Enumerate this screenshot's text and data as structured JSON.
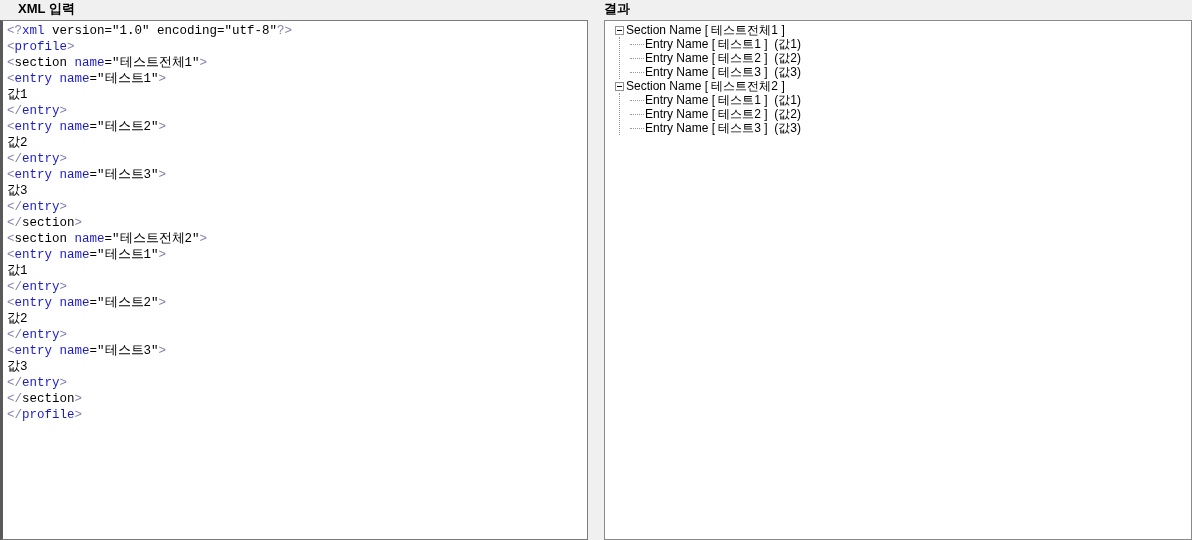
{
  "editor": {
    "title": "XML 입력",
    "lines": [
      [
        {
          "kind": "p",
          "text": "<?"
        },
        {
          "kind": "t",
          "text": "xml"
        },
        {
          "kind": "x",
          "text": " version=\"1.0\" encoding=\"utf-8\""
        },
        {
          "kind": "p",
          "text": "?>"
        }
      ],
      [
        {
          "kind": "p",
          "text": "<"
        },
        {
          "kind": "t",
          "text": "profile"
        },
        {
          "kind": "p",
          "text": ">"
        }
      ],
      [
        {
          "kind": "p",
          "text": "<"
        },
        {
          "kind": "x",
          "text": "section "
        },
        {
          "kind": "t",
          "text": "name"
        },
        {
          "kind": "x",
          "text": "=\"테스트전체1\""
        },
        {
          "kind": "p",
          "text": ">"
        }
      ],
      [
        {
          "kind": "p",
          "text": "<"
        },
        {
          "kind": "t",
          "text": "entry name"
        },
        {
          "kind": "x",
          "text": "=\"테스트1\""
        },
        {
          "kind": "p",
          "text": ">"
        }
      ],
      [
        {
          "kind": "x",
          "text": "값1"
        }
      ],
      [
        {
          "kind": "p",
          "text": "</"
        },
        {
          "kind": "t",
          "text": "entry"
        },
        {
          "kind": "p",
          "text": ">"
        }
      ],
      [
        {
          "kind": "p",
          "text": "<"
        },
        {
          "kind": "t",
          "text": "entry name"
        },
        {
          "kind": "x",
          "text": "=\"테스트2\""
        },
        {
          "kind": "p",
          "text": ">"
        }
      ],
      [
        {
          "kind": "x",
          "text": "값2"
        }
      ],
      [
        {
          "kind": "p",
          "text": "</"
        },
        {
          "kind": "t",
          "text": "entry"
        },
        {
          "kind": "p",
          "text": ">"
        }
      ],
      [
        {
          "kind": "p",
          "text": "<"
        },
        {
          "kind": "t",
          "text": "entry name"
        },
        {
          "kind": "x",
          "text": "=\"테스트3\""
        },
        {
          "kind": "p",
          "text": ">"
        }
      ],
      [
        {
          "kind": "x",
          "text": "값3"
        }
      ],
      [
        {
          "kind": "p",
          "text": "</"
        },
        {
          "kind": "t",
          "text": "entry"
        },
        {
          "kind": "p",
          "text": ">"
        }
      ],
      [
        {
          "kind": "p",
          "text": "</"
        },
        {
          "kind": "x",
          "text": "section"
        },
        {
          "kind": "p",
          "text": ">"
        }
      ],
      [
        {
          "kind": "p",
          "text": "<"
        },
        {
          "kind": "x",
          "text": "section "
        },
        {
          "kind": "t",
          "text": "name"
        },
        {
          "kind": "x",
          "text": "=\"테스트전체2\""
        },
        {
          "kind": "p",
          "text": ">"
        }
      ],
      [
        {
          "kind": "p",
          "text": "<"
        },
        {
          "kind": "t",
          "text": "entry name"
        },
        {
          "kind": "x",
          "text": "=\"테스트1\""
        },
        {
          "kind": "p",
          "text": ">"
        }
      ],
      [
        {
          "kind": "x",
          "text": "값1"
        }
      ],
      [
        {
          "kind": "p",
          "text": "</"
        },
        {
          "kind": "t",
          "text": "entry"
        },
        {
          "kind": "p",
          "text": ">"
        }
      ],
      [
        {
          "kind": "p",
          "text": "<"
        },
        {
          "kind": "t",
          "text": "entry name"
        },
        {
          "kind": "x",
          "text": "=\"테스트2\""
        },
        {
          "kind": "p",
          "text": ">"
        }
      ],
      [
        {
          "kind": "x",
          "text": "값2"
        }
      ],
      [
        {
          "kind": "p",
          "text": "</"
        },
        {
          "kind": "t",
          "text": "entry"
        },
        {
          "kind": "p",
          "text": ">"
        }
      ],
      [
        {
          "kind": "p",
          "text": "<"
        },
        {
          "kind": "t",
          "text": "entry name"
        },
        {
          "kind": "x",
          "text": "=\"테스트3\""
        },
        {
          "kind": "p",
          "text": ">"
        }
      ],
      [
        {
          "kind": "x",
          "text": "값3"
        }
      ],
      [
        {
          "kind": "p",
          "text": "</"
        },
        {
          "kind": "t",
          "text": "entry"
        },
        {
          "kind": "p",
          "text": ">"
        }
      ],
      [
        {
          "kind": "p",
          "text": "</"
        },
        {
          "kind": "x",
          "text": "section"
        },
        {
          "kind": "p",
          "text": ">"
        }
      ],
      [
        {
          "kind": "p",
          "text": "</"
        },
        {
          "kind": "t",
          "text": "profile"
        },
        {
          "kind": "p",
          "text": ">"
        }
      ]
    ]
  },
  "result": {
    "title": "결과",
    "tree": [
      {
        "label": "Section Name [ 테스트전체1 ]",
        "expanded": true,
        "children": [
          {
            "label": "Entry Name [ 테스트1 ]  (값1)"
          },
          {
            "label": "Entry Name [ 테스트2 ]  (값2)"
          },
          {
            "label": "Entry Name [ 테스트3 ]  (값3)"
          }
        ]
      },
      {
        "label": "Section Name [ 테스트전체2 ]",
        "expanded": true,
        "children": [
          {
            "label": "Entry Name [ 테스트1 ]  (값1)"
          },
          {
            "label": "Entry Name [ 테스트2 ]  (값2)"
          },
          {
            "label": "Entry Name [ 테스트3 ]  (값3)"
          }
        ]
      }
    ]
  }
}
